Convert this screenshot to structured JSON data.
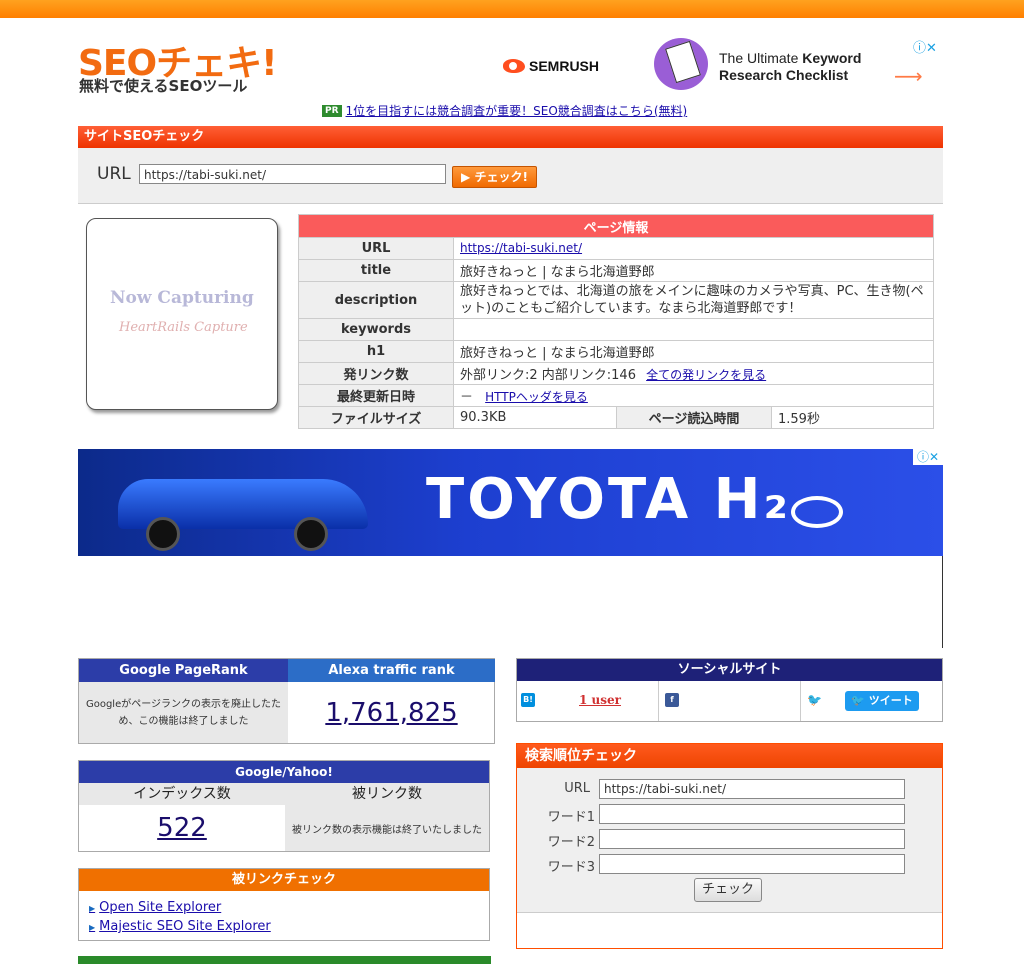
{
  "header": {
    "logo_main": "SEOチェキ!",
    "logo_sub": "無料で使えるSEOツール"
  },
  "ad_top": {
    "brand": "SEMRUSH",
    "line1_light": "The Ultimate ",
    "line1_bold": "Keyword",
    "line2": "Research Checklist",
    "arrow": "⟶",
    "close": "ⓘ✕"
  },
  "pr": {
    "badge": "PR",
    "link": "1位を目指すには競合調査が重要！SEO競合調査はこちら(無料)"
  },
  "site_check": {
    "title": "サイトSEOチェック",
    "url_label": "URL",
    "url_value": "https://tabi-suki.net/",
    "button": "▶ チェック!"
  },
  "capture": {
    "line1": "Now Capturing",
    "line2": "HeartRails Capture"
  },
  "page_info": {
    "title": "ページ情報",
    "url_label": "URL",
    "url_value": "https://tabi-suki.net/",
    "title_label": "title",
    "title_value": "旅好きねっと | なまら北海道野郎",
    "desc_label": "description",
    "desc_value": "旅好きねっとでは、北海道の旅をメインに趣味のカメラや写真、PC、生き物(ペット)のこともご紹介しています。なまら北海道野郎です！",
    "keywords_label": "keywords",
    "keywords_value": "",
    "h1_label": "h1",
    "h1_value": "旅好きねっと | なまら北海道野郎",
    "links_label": "発リンク数",
    "links_value": "外部リンク:2  内部リンク:146",
    "links_link": "全ての発リンクを見る",
    "updated_label": "最終更新日時",
    "updated_value": "－",
    "updated_link": "HTTPヘッダを見る",
    "size_label": "ファイルサイズ",
    "size_value": "90.3KB",
    "load_label": "ページ読込時間",
    "load_value": "1.59秒"
  },
  "toyota_ad": {
    "text": "TOYOTA H₂",
    "close": "ⓘ✕"
  },
  "pagerank": {
    "google_head": "Google PageRank",
    "alexa_head": "Alexa traffic rank",
    "google_msg": "Googleがページランクの表示を廃止したため、この機能は終了しました",
    "alexa_value": "1,761,825"
  },
  "google_yahoo": {
    "head": "Google/Yahoo!",
    "index_label": "インデックス数",
    "backlink_label": "被リンク数",
    "index_value": "522",
    "backlink_msg": "被リンク数の表示機能は終了いたしました"
  },
  "backlink_check": {
    "head": "被リンクチェック",
    "link1": "Open Site Explorer",
    "link2": "Majestic SEO Site Explorer"
  },
  "social": {
    "head": "ソーシャルサイト",
    "hatena_icon": "B!",
    "hatena_users": "1 user",
    "fb_icon": "f",
    "tw_icon": "🐦",
    "tweet": "🐦 ツイート"
  },
  "rank_check": {
    "head": "検索順位チェック",
    "url_label": "URL",
    "url_value": "https://tabi-suki.net/",
    "word1": "ワード1",
    "word2": "ワード2",
    "word3": "ワード3",
    "button": "チェック"
  }
}
